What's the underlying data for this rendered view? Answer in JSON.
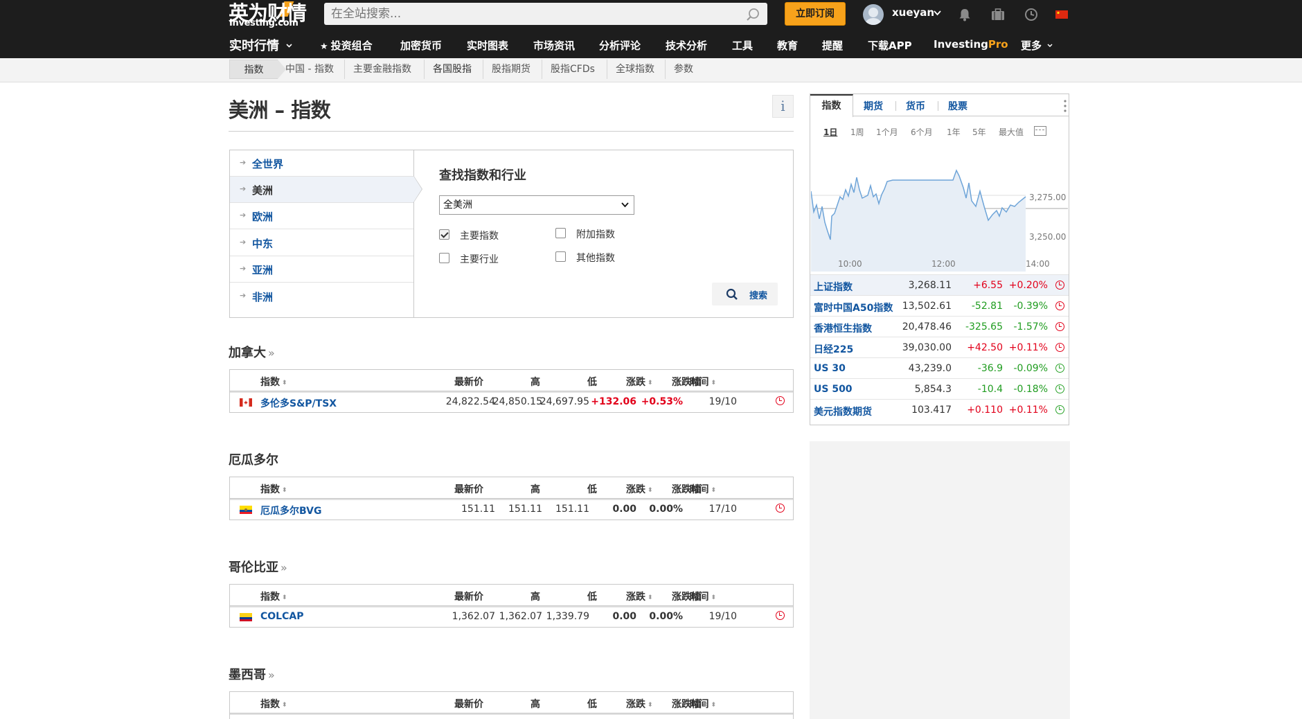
{
  "header": {
    "logo_cn": "英为财情",
    "logo_en": "Investing.com",
    "search_placeholder": "在全站搜索...",
    "subscribe_label": "立即订阅",
    "username": "xueyan",
    "icons": [
      "bell-icon",
      "briefcase-icon",
      "clock-icon",
      "china-flag-icon"
    ]
  },
  "nav": {
    "realtime": "实时行情",
    "items": [
      "投资组合",
      "加密货币",
      "实时图表",
      "市场资讯",
      "分析评论",
      "技术分析",
      "工具",
      "教育",
      "提醒",
      "下载APP"
    ],
    "pro_a": "Investing",
    "pro_b": "Pro",
    "more": "更多"
  },
  "subnav": {
    "items": [
      "指数",
      "中国 - 指数",
      "主要金融指数",
      "各国股指",
      "股指期货",
      "股指CFDs",
      "全球指数",
      "参数"
    ],
    "active_index": 3
  },
  "page": {
    "title": "美洲 – 指数",
    "info": "i"
  },
  "finder": {
    "regions": [
      "全世界",
      "美洲",
      "欧洲",
      "中东",
      "亚洲",
      "非洲"
    ],
    "active_region_index": 1,
    "title": "查找指数和行业",
    "select_value": "全美洲",
    "checkboxes": [
      {
        "label": "主要指数",
        "checked": true
      },
      {
        "label": "附加指数",
        "checked": false
      },
      {
        "label": "主要行业",
        "checked": false
      },
      {
        "label": "其他指数",
        "checked": false
      }
    ],
    "search_label": "搜索"
  },
  "table_headers": {
    "name": "指数",
    "last": "最新价",
    "high": "高",
    "low": "低",
    "chg": "涨跌",
    "chg_pct": "涨跌幅",
    "time": "时间"
  },
  "countries": [
    {
      "title": "加拿大",
      "more": "»",
      "rows": [
        {
          "flag": "canada",
          "name": "多伦多S&P/TSX",
          "last": "24,822.54",
          "high": "24,850.15",
          "low": "24,697.95",
          "chg": "+132.06",
          "chg_pct": "+0.53%",
          "time": "19/10",
          "dir": "up"
        }
      ]
    },
    {
      "title": "厄瓜多尔",
      "more": "",
      "rows": [
        {
          "flag": "ecuador",
          "name": "厄瓜多尔BVG",
          "last": "151.11",
          "high": "151.11",
          "low": "151.11",
          "chg": "0.00",
          "chg_pct": "0.00%",
          "time": "17/10",
          "dir": "flat"
        }
      ]
    },
    {
      "title": "哥伦比亚",
      "more": "»",
      "rows": [
        {
          "flag": "colombia",
          "name": "COLCAP",
          "last": "1,362.07",
          "high": "1,362.07",
          "low": "1,339.79",
          "chg": "0.00",
          "chg_pct": "0.00%",
          "time": "19/10",
          "dir": "flat"
        }
      ]
    },
    {
      "title": "墨西哥",
      "more": "»",
      "rows": []
    }
  ],
  "widget": {
    "tabs": [
      "指数",
      "期货",
      "货币",
      "股票"
    ],
    "periods": [
      "1日",
      "1周",
      "1个月",
      "6个月",
      "1年",
      "5年",
      "最大值"
    ],
    "chart": {
      "y_ticks": [
        "3,275.00",
        "3,250.00"
      ],
      "x_ticks": [
        "10:00",
        "12:00",
        "14:00"
      ]
    },
    "quotes": [
      {
        "name": "上证指数",
        "last": "3,268.11",
        "chg": "+6.55",
        "pct": "+0.20%",
        "dir": "up",
        "status": "closed"
      },
      {
        "name": "富时中国A50指数",
        "last": "13,502.61",
        "chg": "-52.81",
        "pct": "-0.39%",
        "dir": "down",
        "status": "closed"
      },
      {
        "name": "香港恒生指数",
        "last": "20,478.46",
        "chg": "-325.65",
        "pct": "-1.57%",
        "dir": "down",
        "status": "closed"
      },
      {
        "name": "日经225",
        "last": "39,030.00",
        "chg": "+42.50",
        "pct": "+0.11%",
        "dir": "up",
        "status": "closed"
      },
      {
        "name": "US 30",
        "last": "43,239.0",
        "chg": "-36.9",
        "pct": "-0.09%",
        "dir": "down",
        "status": "open"
      },
      {
        "name": "US 500",
        "last": "5,854.3",
        "chg": "-10.4",
        "pct": "-0.18%",
        "dir": "down",
        "status": "open"
      },
      {
        "name": "美元指数期货",
        "last": "103.417",
        "chg": "+0.110",
        "pct": "+0.11%",
        "dir": "up",
        "status": "open"
      }
    ]
  },
  "colors": {
    "brand": "#f7a21b",
    "up": "#e2001a",
    "down": "#1f9c1f",
    "link": "#1256a0"
  }
}
